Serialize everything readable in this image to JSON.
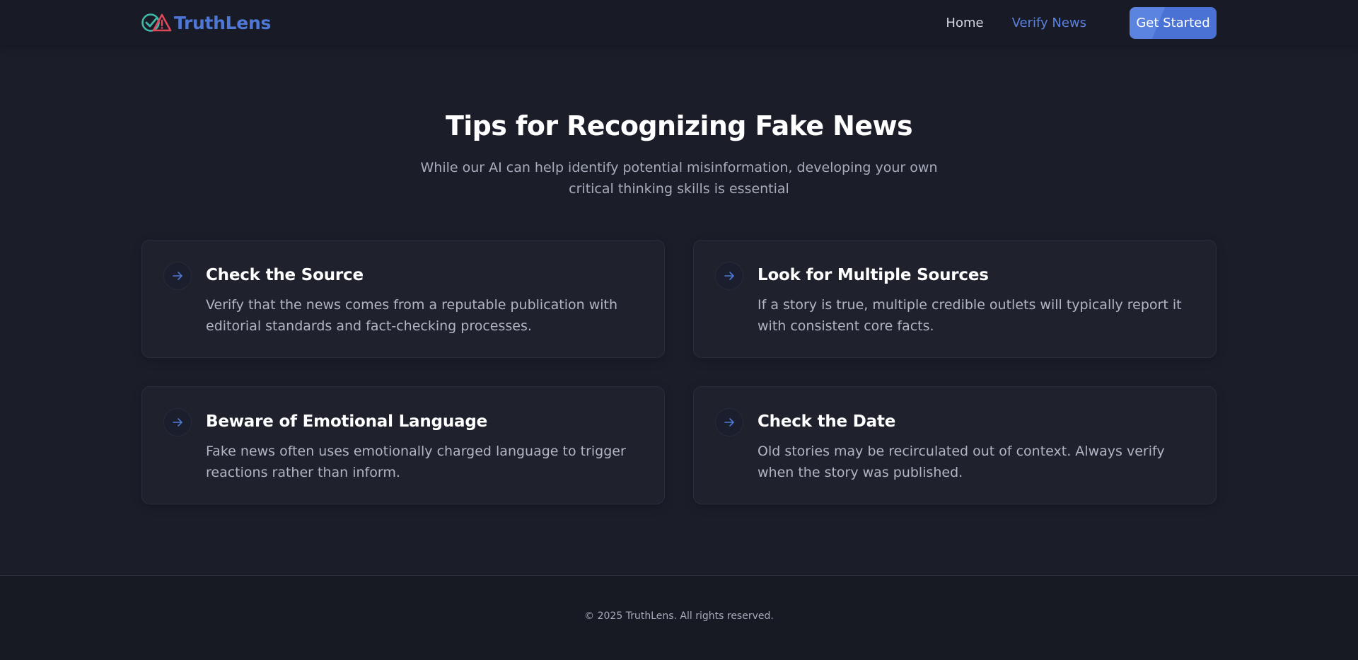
{
  "header": {
    "brand_name": "TruthLens",
    "logo_icon": "check-warning-logo-icon",
    "nav_links": [
      {
        "label": "Home",
        "active": false
      },
      {
        "label": "Verify News",
        "active": true
      }
    ],
    "cta_label": "Get Started"
  },
  "hero": {
    "title": "Tips for Recognizing Fake News",
    "subtitle": "While our AI can help identify potential misinformation, developing your own critical thinking skills is essential"
  },
  "tips": [
    {
      "icon": "arrow-right-icon",
      "title": "Check the Source",
      "text": "Verify that the news comes from a reputable publication with editorial standards and fact-checking processes."
    },
    {
      "icon": "arrow-right-icon",
      "title": "Look for Multiple Sources",
      "text": "If a story is true, multiple credible outlets will typically report it with consistent core facts."
    },
    {
      "icon": "arrow-right-icon",
      "title": "Beware of Emotional Language",
      "text": "Fake news often uses emotionally charged language to trigger reactions rather than inform."
    },
    {
      "icon": "arrow-right-icon",
      "title": "Check the Date",
      "text": "Old stories may be recirculated out of context. Always verify when the story was published."
    }
  ],
  "footer": {
    "copyright": "© 2025 TruthLens. All rights reserved."
  },
  "colors": {
    "background": "#1b1d29",
    "accent": "#4f78d6",
    "logo_check": "#3fb8a7",
    "logo_warning": "#e0475a"
  }
}
